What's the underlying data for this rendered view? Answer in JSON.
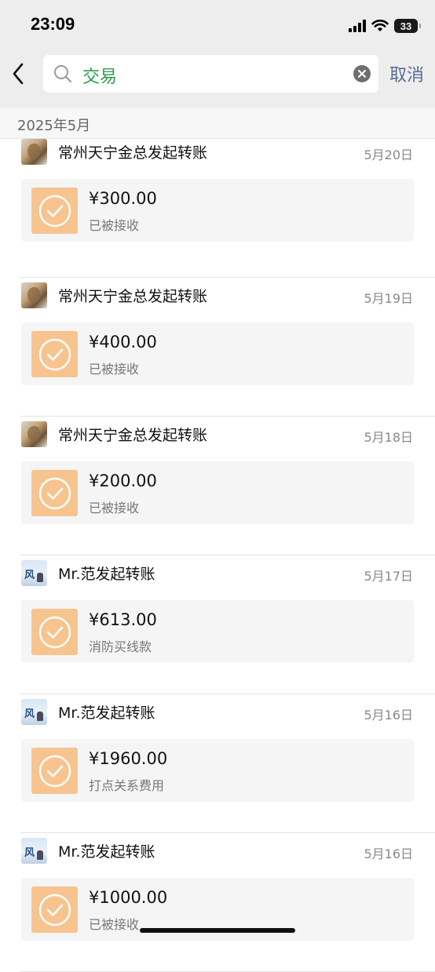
{
  "status_bar": {
    "time": "23:09",
    "battery": "33"
  },
  "search": {
    "query": "交易",
    "cancel_label": "取消"
  },
  "section": {
    "month_label": "2025年5月"
  },
  "transactions": [
    {
      "sender_title": "常州天宁金总发起转账",
      "date": "5月20日",
      "amount": "¥300.00",
      "note": "已被接收",
      "avatar": "tiger-avatar"
    },
    {
      "sender_title": "常州天宁金总发起转账",
      "date": "5月19日",
      "amount": "¥400.00",
      "note": "已被接收",
      "avatar": "tiger-avatar"
    },
    {
      "sender_title": "常州天宁金总发起转账",
      "date": "5月18日",
      "amount": "¥200.00",
      "note": "已被接收",
      "avatar": "tiger-avatar"
    },
    {
      "sender_title": "Mr.范发起转账",
      "date": "5月17日",
      "amount": "¥613.00",
      "note": "消防买线款",
      "avatar": "wind-painting-avatar"
    },
    {
      "sender_title": "Mr.范发起转账",
      "date": "5月16日",
      "amount": "¥1960.00",
      "note": "打点关系费用",
      "avatar": "wind-painting-avatar"
    },
    {
      "sender_title": "Mr.范发起转账",
      "date": "5月16日",
      "amount": "¥1000.00",
      "note": "已被接收",
      "avatar": "wind-painting-avatar"
    }
  ],
  "colors": {
    "search_query": "#2a9d4e",
    "cancel": "#576b95",
    "transfer_icon_bg": "#f7c490"
  }
}
